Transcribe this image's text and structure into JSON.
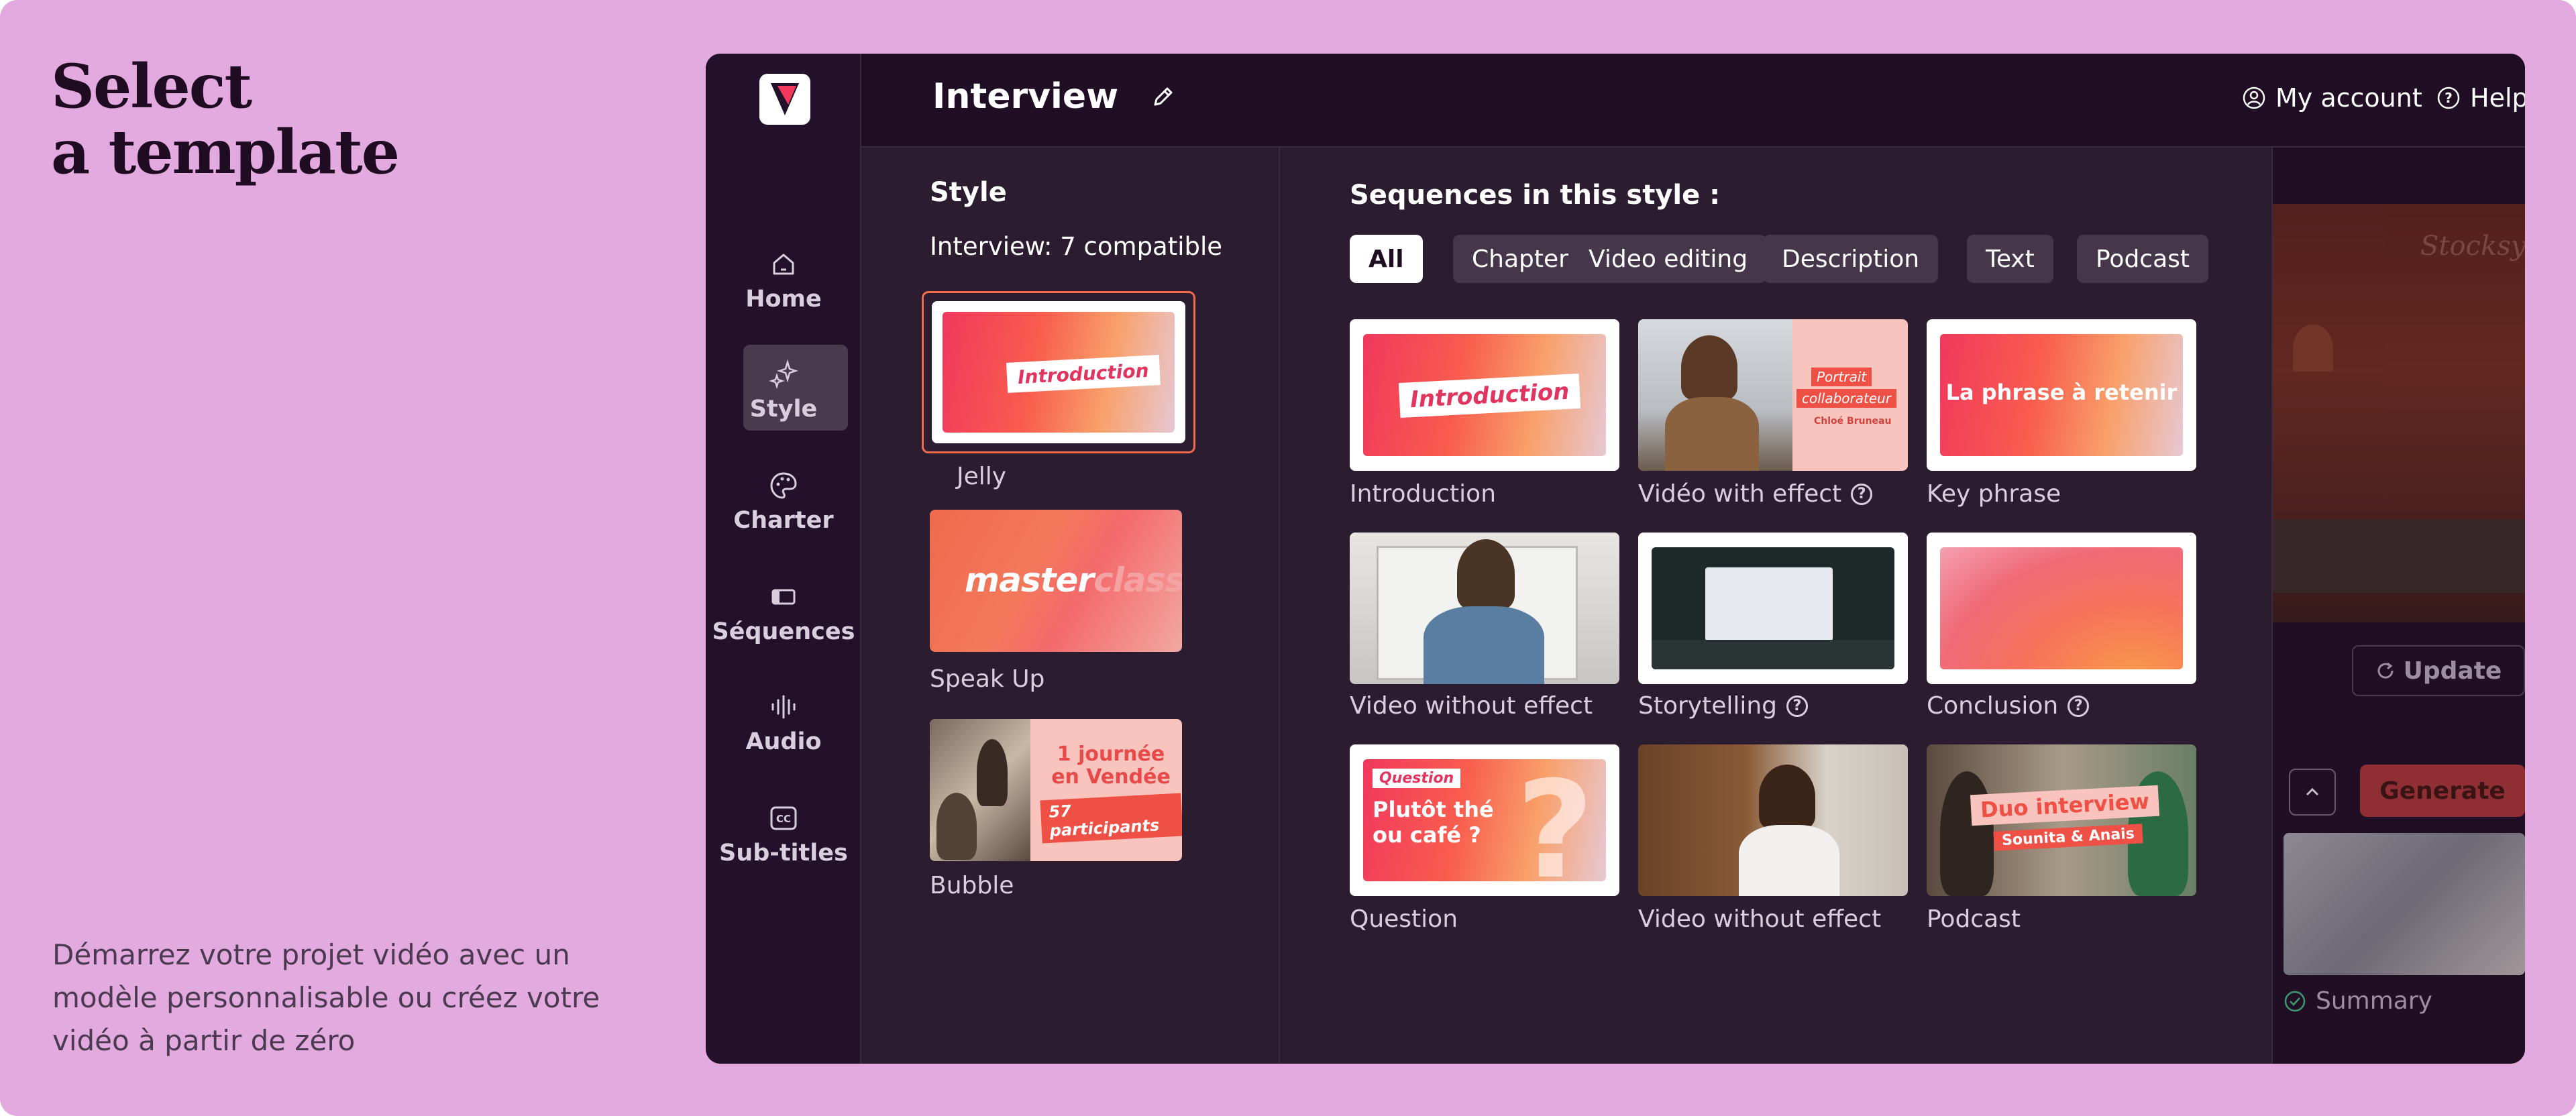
{
  "hero": {
    "title_line1": "Select",
    "title_line2": "a template",
    "description": "Démarrez votre projet vidéo avec un modèle personnalisable ou créez votre vidéo à partir de zéro"
  },
  "topbar": {
    "title": "Interview",
    "account_label": "My account",
    "help_label": "Help"
  },
  "sidebar": {
    "items": [
      {
        "label": "Home",
        "icon": "home-icon"
      },
      {
        "label": "Style",
        "icon": "sparkles-icon"
      },
      {
        "label": "Charter",
        "icon": "palette-icon"
      },
      {
        "label": "Séquences",
        "icon": "sequences-icon"
      },
      {
        "label": "Audio",
        "icon": "waveform-icon"
      },
      {
        "label": "Sub-titles",
        "icon": "cc-icon"
      }
    ],
    "active": "Style"
  },
  "style_panel": {
    "title": "Style",
    "compatible": "Interview: 7 compatible",
    "styles": [
      {
        "label": "Jelly",
        "overlay": "Introduction"
      },
      {
        "label": "Speak Up",
        "overlay_bold": "master",
        "overlay_light": "class"
      },
      {
        "label": "Bubble",
        "overlay_line1": "1 journée",
        "overlay_line2": "en Vendée",
        "overlay_tag": "57 participants"
      }
    ]
  },
  "sequences": {
    "title": "Sequences in this style :",
    "filters": [
      "All",
      "Chapter",
      "Video editing",
      "Description",
      "Text",
      "Podcast"
    ],
    "active_filter": "All",
    "items": [
      {
        "label": "Introduction",
        "overlay": "Introduction",
        "help": false
      },
      {
        "label": "Vidéo with effect",
        "overlay_tag1": "Portrait",
        "overlay_tag2": "collaborateur",
        "overlay_name": "Chloé Bruneau",
        "help": true
      },
      {
        "label": "Key phrase",
        "overlay": "La phrase à retenir",
        "help": false
      },
      {
        "label": "Video without effect",
        "help": false
      },
      {
        "label": "Storytelling",
        "help": true
      },
      {
        "label": "Conclusion",
        "help": true
      },
      {
        "label": "Question",
        "overlay_tag": "Question",
        "overlay_line1": "Plutôt thé",
        "overlay_line2": "ou café ?",
        "help": false
      },
      {
        "label": "Video without effect",
        "help": false
      },
      {
        "label": "Podcast",
        "overlay": "Duo interview",
        "overlay_tag": "Sounita & Anais",
        "help": false
      }
    ]
  },
  "preview": {
    "update_label": "Update",
    "generate_label": "Generate",
    "summary_label": "Summary",
    "watermark": "Stocksy"
  },
  "colors": {
    "background": "#e3aadf",
    "app_bg": "#2c1c2f",
    "accent": "#f2385d",
    "generate": "#8f2f34"
  }
}
